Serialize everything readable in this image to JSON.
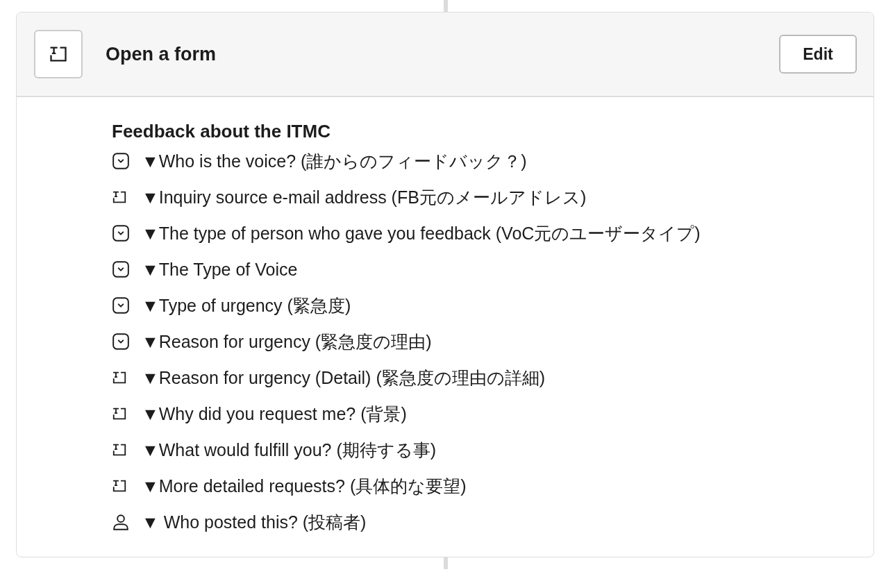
{
  "step": {
    "title": "Open a form",
    "button": "Edit"
  },
  "form": {
    "title": "Feedback about the ITMC",
    "fields": [
      {
        "kind": "select",
        "label": "▼Who is the voice? (誰からのフィードバック？)"
      },
      {
        "kind": "text",
        "label": "▼Inquiry source e-mail address (FB元のメールアドレス)"
      },
      {
        "kind": "select",
        "label": "▼The type of person who gave you feedback (VoC元のユーザータイプ)"
      },
      {
        "kind": "select",
        "label": "▼The Type of Voice"
      },
      {
        "kind": "select",
        "label": "▼Type of urgency (緊急度)"
      },
      {
        "kind": "select",
        "label": "▼Reason for urgency (緊急度の理由)"
      },
      {
        "kind": "text",
        "label": "▼Reason for urgency (Detail) (緊急度の理由の詳細)"
      },
      {
        "kind": "text",
        "label": "▼Why did you request me? (背景)"
      },
      {
        "kind": "text",
        "label": "▼What would fulfill you? (期待する事)"
      },
      {
        "kind": "text",
        "label": "▼More detailed requests? (具体的な要望)"
      },
      {
        "kind": "user",
        "label": "▼ Who posted this? (投稿者)"
      }
    ]
  }
}
